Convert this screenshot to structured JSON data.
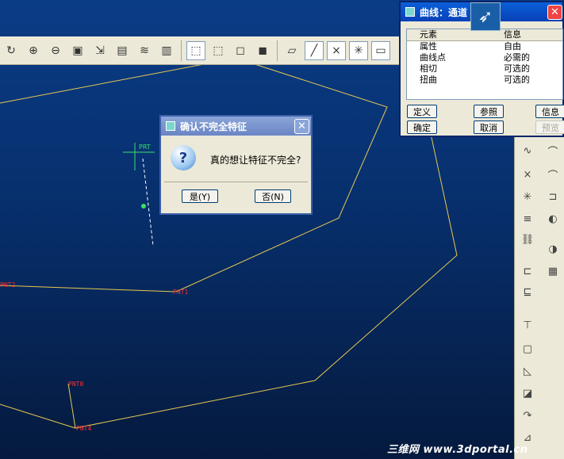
{
  "curve_panel": {
    "title": "曲线：通道",
    "columns": [
      "元素",
      "信息"
    ],
    "rows": [
      {
        "element": "属性",
        "info": "自由"
      },
      {
        "element": "曲线点",
        "info": "必需的"
      },
      {
        "element": "相切",
        "info": "可选的"
      },
      {
        "element": "扭曲",
        "info": "可选的"
      }
    ],
    "buttons": {
      "define": "定义",
      "reference": "参照",
      "info": "信息",
      "ok": "确定",
      "cancel": "取消",
      "preview": "预览"
    }
  },
  "confirm_dialog": {
    "title": "确认不完全特征",
    "message": "真的想让特征不完全?",
    "yes_label": "是(Y)",
    "no_label": "否(N)"
  },
  "scene": {
    "points": [
      "PNT0",
      "PNT1",
      "PNT2",
      "PNT4"
    ],
    "csys_label": "PRT"
  },
  "watermark": "三维网 www.3dportal.cn",
  "colors": {
    "background_top": "#0a3c86",
    "background_bottom": "#051a3e",
    "curve_line": "#e8c850",
    "point_label": "#ff3030",
    "titlebar_active": "#0a5fd8",
    "titlebar_inactive": "#8aa5d8"
  }
}
